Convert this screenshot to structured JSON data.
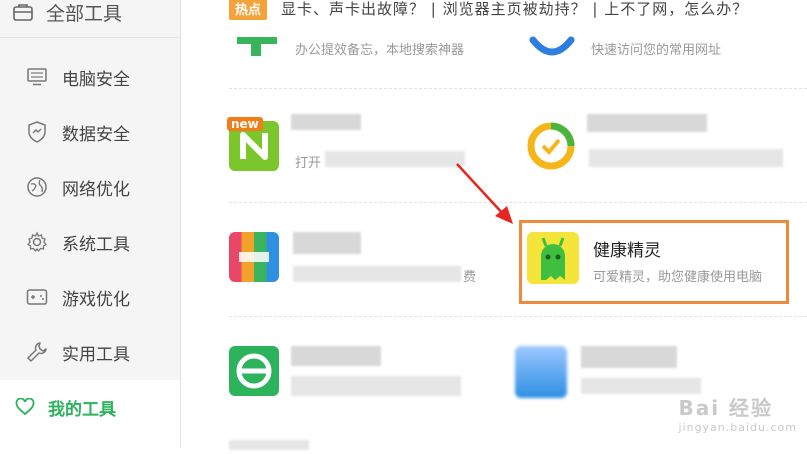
{
  "sidebar": {
    "all_tools": "全部工具",
    "items": [
      {
        "label": "电脑安全"
      },
      {
        "label": "数据安全"
      },
      {
        "label": "网络优化"
      },
      {
        "label": "系统工具"
      },
      {
        "label": "游戏优化"
      },
      {
        "label": "实用工具"
      }
    ],
    "my_tools": "我的工具"
  },
  "main": {
    "hot_badge": "热点",
    "hot_text": "显卡、声卡出故障？ | 浏览器主页被劫持？ | 上不了网，怎么办？",
    "row0": [
      {
        "desc": "办公提效备忘，本地搜索神器"
      },
      {
        "desc": "快速访问您的常用网址"
      }
    ],
    "row1_left": {
      "badge": "new",
      "desc_prefix": "打开"
    },
    "row2_left": {
      "desc_suffix": "费"
    },
    "health": {
      "name": "健康精灵",
      "desc": "可爱精灵，助您健康使用电脑"
    }
  },
  "watermark": {
    "main": "Bai 经验",
    "sub": "jingyan.baidu.com"
  },
  "colors": {
    "accent": "#2db35c",
    "hot": "#f6a23a",
    "highlight": "#f08a3a",
    "arrow": "#e8261f"
  }
}
